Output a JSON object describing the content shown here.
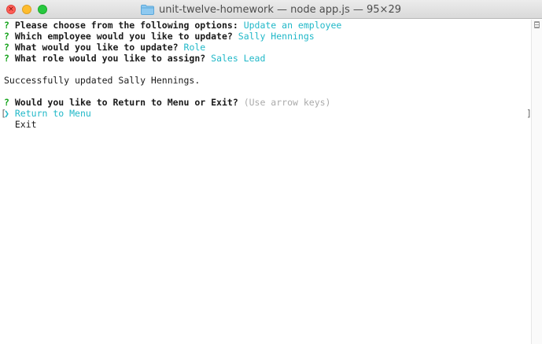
{
  "window": {
    "title": "unit-twelve-homework — node app.js — 95×29",
    "folder_icon": "folder-icon",
    "controls": [
      "close",
      "minimize",
      "zoom"
    ]
  },
  "terminal": {
    "prompts": [
      {
        "mark": "?",
        "question": "Please choose from the following options:",
        "answer": "Update an employee"
      },
      {
        "mark": "?",
        "question": "Which employee would you like to update?",
        "answer": "Sally Hennings"
      },
      {
        "mark": "?",
        "question": "What would you like to update?",
        "answer": "Role"
      },
      {
        "mark": "?",
        "question": "What role would you like to assign?",
        "answer": "Sales Lead"
      }
    ],
    "message": "Successfully updated Sally Hennings.",
    "menu_prompt": {
      "mark": "?",
      "question": "Would you like to Return to Menu or Exit?",
      "hint": "(Use arrow keys)"
    },
    "menu_options": [
      {
        "pointer": "❯",
        "label": "Return to Menu",
        "selected": true
      },
      {
        "pointer": "",
        "label": "Exit",
        "selected": false
      }
    ],
    "left_bracket": "[",
    "right_bracket": "]"
  },
  "colors": {
    "prompt_mark": "#15a31a",
    "answer": "#20b8c8",
    "hint": "#aaaaaa"
  }
}
